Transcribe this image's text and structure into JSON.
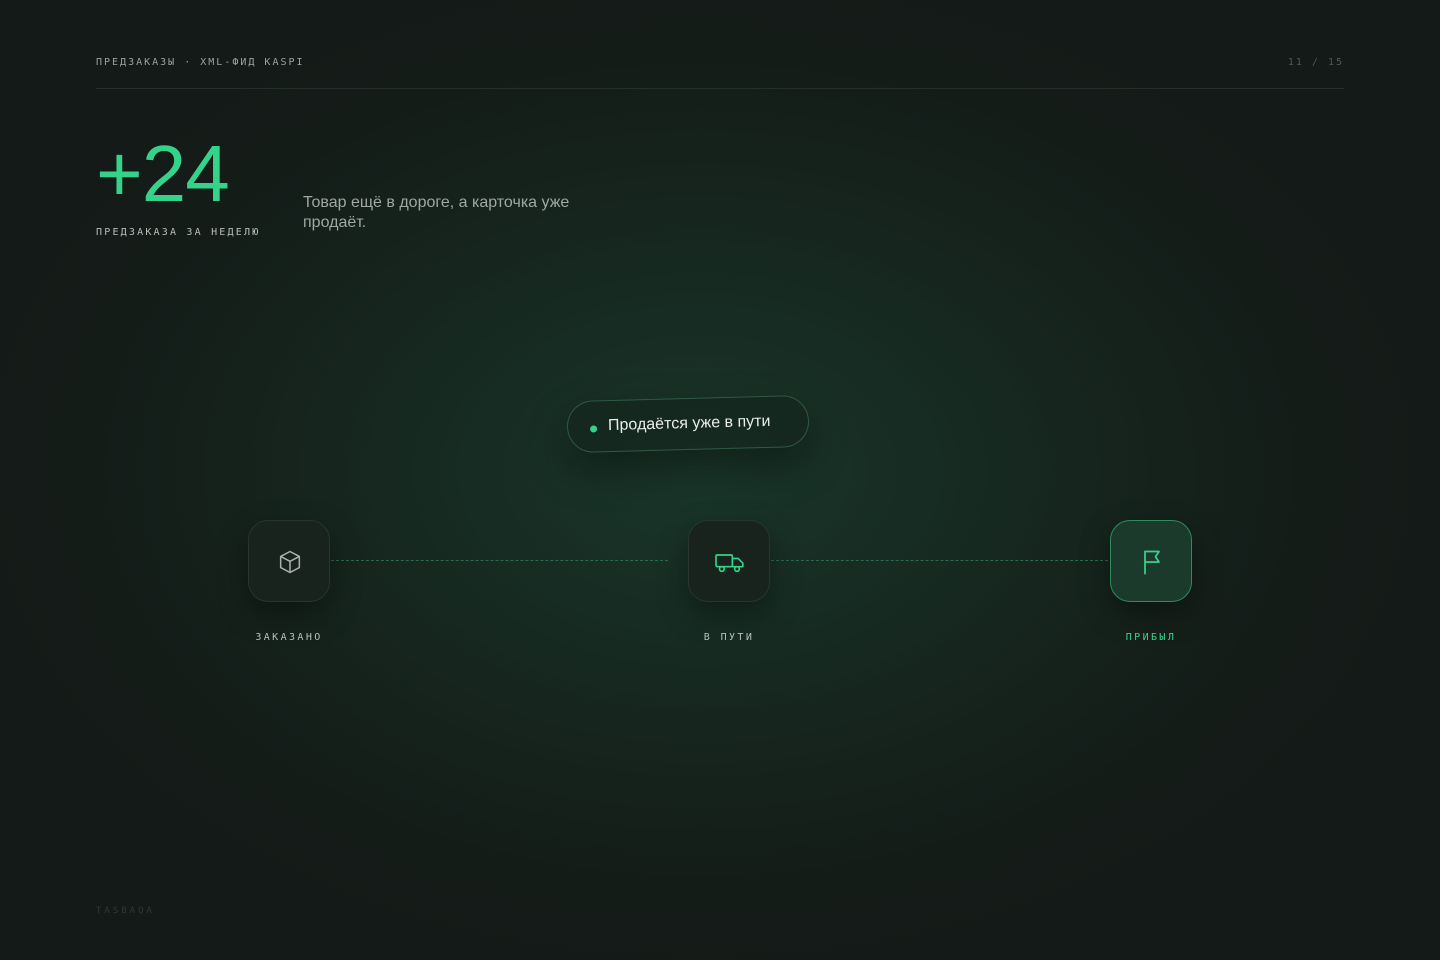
{
  "header": {
    "breadcrumb": "ПРЕДЗАКАЗЫ · XML-ФИД KASPI",
    "pager": "11 / 15"
  },
  "stat": {
    "value": "+24",
    "caption": "ПРЕДЗАКАЗА ЗА НЕДЕЛЮ",
    "tagline": "Товар ещё в дороге, а карточка уже продаёт."
  },
  "badge": {
    "text": "Продаётся уже в пути"
  },
  "steps": [
    {
      "label": "ЗАКАЗАНО",
      "icon": "box-icon",
      "active": false
    },
    {
      "label": "В ПУТИ",
      "icon": "truck-icon",
      "active": false
    },
    {
      "label": "ПРИБЫЛ",
      "icon": "flag-icon",
      "active": true
    }
  ],
  "footer": {
    "brand": "TASBAQA"
  },
  "colors": {
    "accent": "#35d38a",
    "background": "#141b18"
  }
}
